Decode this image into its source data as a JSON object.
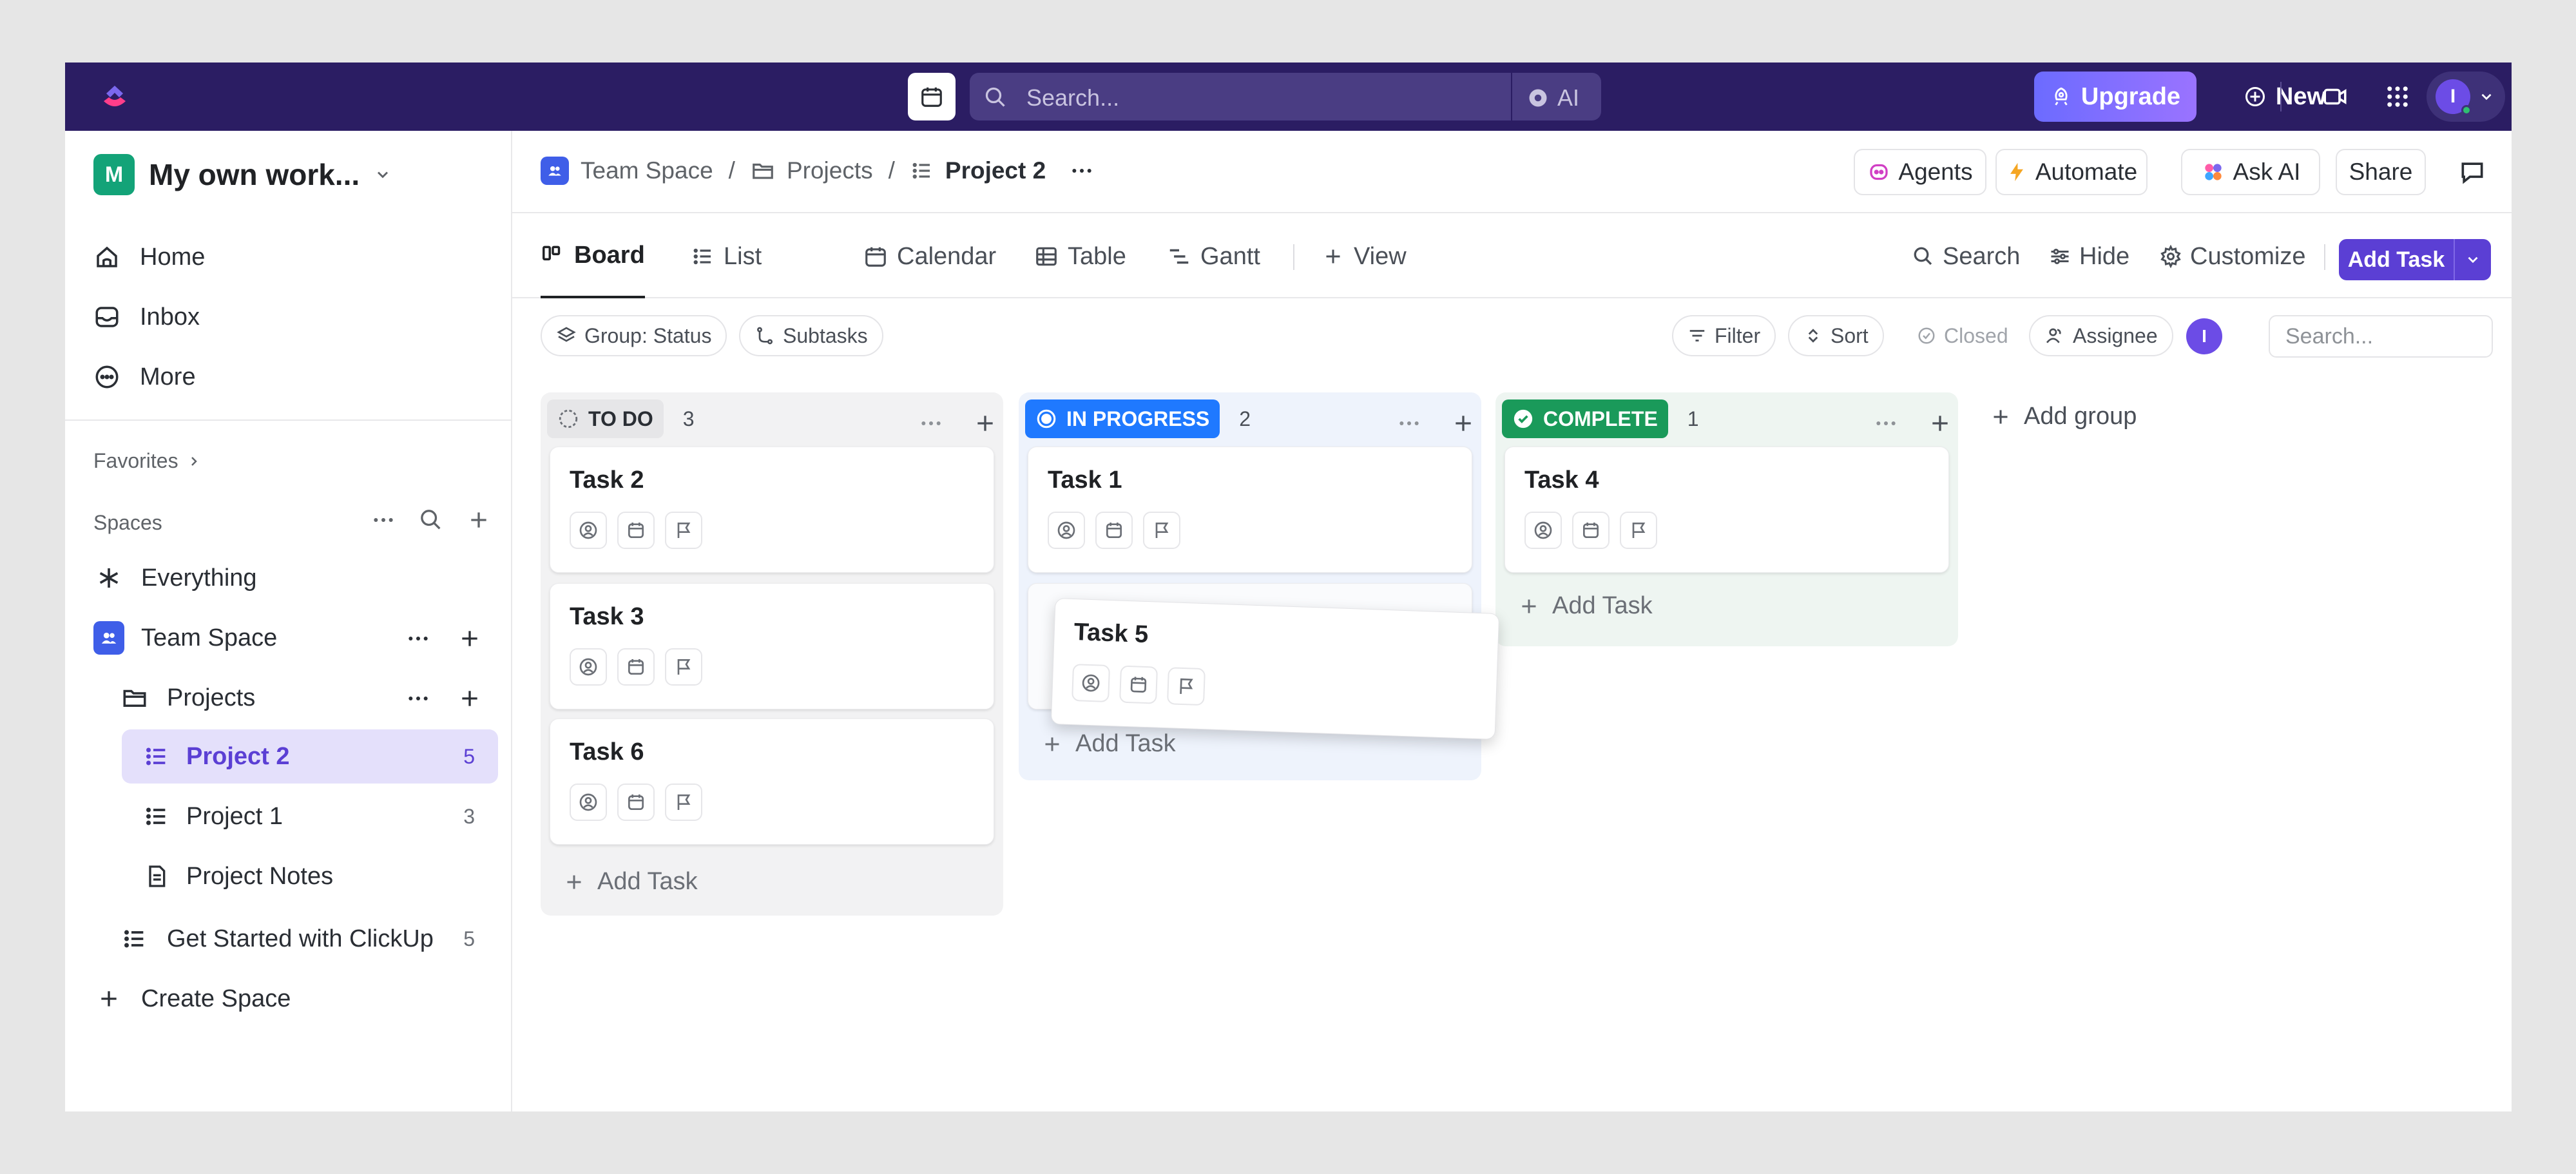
{
  "topbar": {
    "search_placeholder": "Search...",
    "ai_label": "AI",
    "upgrade_label": "Upgrade",
    "new_label": "New",
    "avatar_initial": "I"
  },
  "sidebar": {
    "workspace_initial": "M",
    "workspace_name": "My own work...",
    "nav": [
      {
        "label": "Home"
      },
      {
        "label": "Inbox"
      },
      {
        "label": "More"
      }
    ],
    "favorites_label": "Favorites",
    "spaces_label": "Spaces",
    "tree": {
      "everything": "Everything",
      "team_space": "Team Space",
      "projects": "Projects",
      "project2": {
        "label": "Project 2",
        "count": "5"
      },
      "project1": {
        "label": "Project 1",
        "count": "3"
      },
      "project_notes": "Project Notes",
      "get_started": {
        "label": "Get Started with ClickUp",
        "count": "5"
      },
      "create_space": "Create Space"
    }
  },
  "header": {
    "breadcrumb": [
      "Team Space",
      "Projects",
      "Project 2"
    ],
    "agents": "Agents",
    "automate": "Automate",
    "ask_ai": "Ask AI",
    "share": "Share"
  },
  "views": {
    "tabs": [
      "Board",
      "List",
      "Calendar",
      "Table",
      "Gantt"
    ],
    "add_view": "View",
    "search": "Search",
    "hide": "Hide",
    "customize": "Customize",
    "add_task": "Add Task"
  },
  "filters": {
    "group": "Group: Status",
    "subtasks": "Subtasks",
    "filter": "Filter",
    "sort": "Sort",
    "closed": "Closed",
    "assignee": "Assignee",
    "assignee_initial": "I",
    "search_placeholder": "Search..."
  },
  "board": {
    "columns": [
      {
        "status": "TO DO",
        "count": "3",
        "tasks": [
          "Task 2",
          "Task 3",
          "Task 6"
        ],
        "color": "#e8e8ea"
      },
      {
        "status": "IN PROGRESS",
        "count": "2",
        "tasks": [
          "Task 1"
        ],
        "color": "#1f79ff"
      },
      {
        "status": "COMPLETE",
        "count": "1",
        "tasks": [
          "Task 4"
        ],
        "color": "#1a9a5a"
      }
    ],
    "dragging_task": "Task 5",
    "add_task_label": "Add Task",
    "add_group_label": "Add group"
  }
}
